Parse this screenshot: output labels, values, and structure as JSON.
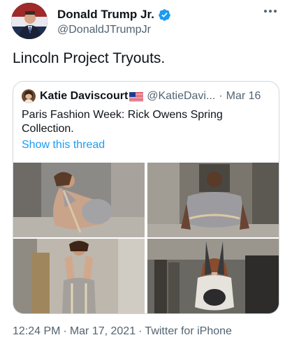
{
  "tweet": {
    "author": {
      "display_name": "Donald Trump Jr.",
      "handle": "@DonaldJTrumpJr",
      "avatar_icon": "profile-photo",
      "verified_icon": "verified-badge-icon"
    },
    "more_icon": "more-options-icon",
    "text": "Lincoln Project Tryouts.",
    "quoted_tweet": {
      "author": {
        "display_name": "Katie Daviscourt",
        "flag_icon": "us-flag-icon",
        "handle": "@KatieDavi...",
        "separator": "·",
        "date": "Mar 16"
      },
      "text": "Paris Fashion Week: Rick Owens Spring Collection.",
      "show_thread_label": "Show this thread",
      "media": [
        {
          "description_icon": "runway-photo-1"
        },
        {
          "description_icon": "runway-photo-2"
        },
        {
          "description_icon": "runway-photo-3"
        },
        {
          "description_icon": "runway-photo-4"
        }
      ]
    },
    "meta": {
      "time": "12:24 PM",
      "date": "Mar 17, 2021",
      "source": "Twitter for iPhone",
      "separator": "·"
    }
  },
  "colors": {
    "text_primary": "#0f1419",
    "text_secondary": "#536471",
    "link": "#1d9bf0",
    "verified": "#1d9bf0",
    "border": "#cfd9de"
  }
}
